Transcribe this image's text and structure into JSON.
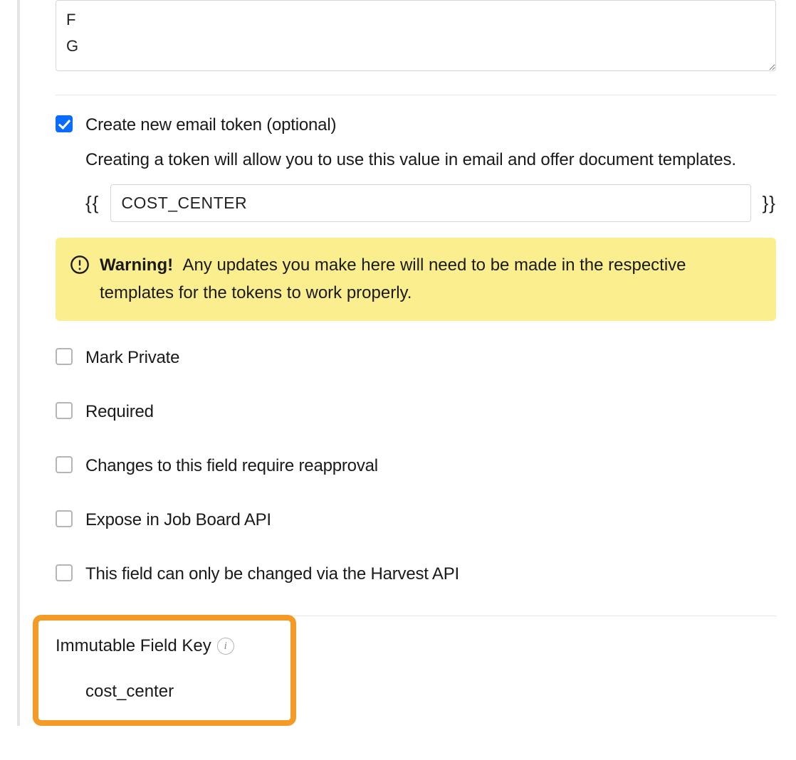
{
  "textarea_content": "F\nG",
  "token": {
    "checkbox_label": "Create new email token (optional)",
    "description": "Creating a token will allow you to use this value in email and offer document templates.",
    "brace_open": "{{",
    "brace_close": "}}",
    "value": "COST_CENTER"
  },
  "warning": {
    "title": "Warning!",
    "message": "Any updates you make here will need to be made in the respective templates for the tokens to work properly."
  },
  "options": {
    "mark_private": "Mark Private",
    "required": "Required",
    "reapproval": "Changes to this field require reapproval",
    "expose_api": "Expose in Job Board API",
    "harvest_only": "This field can only be changed via the Harvest API"
  },
  "field_key": {
    "label": "Immutable Field Key",
    "value": "cost_center"
  }
}
